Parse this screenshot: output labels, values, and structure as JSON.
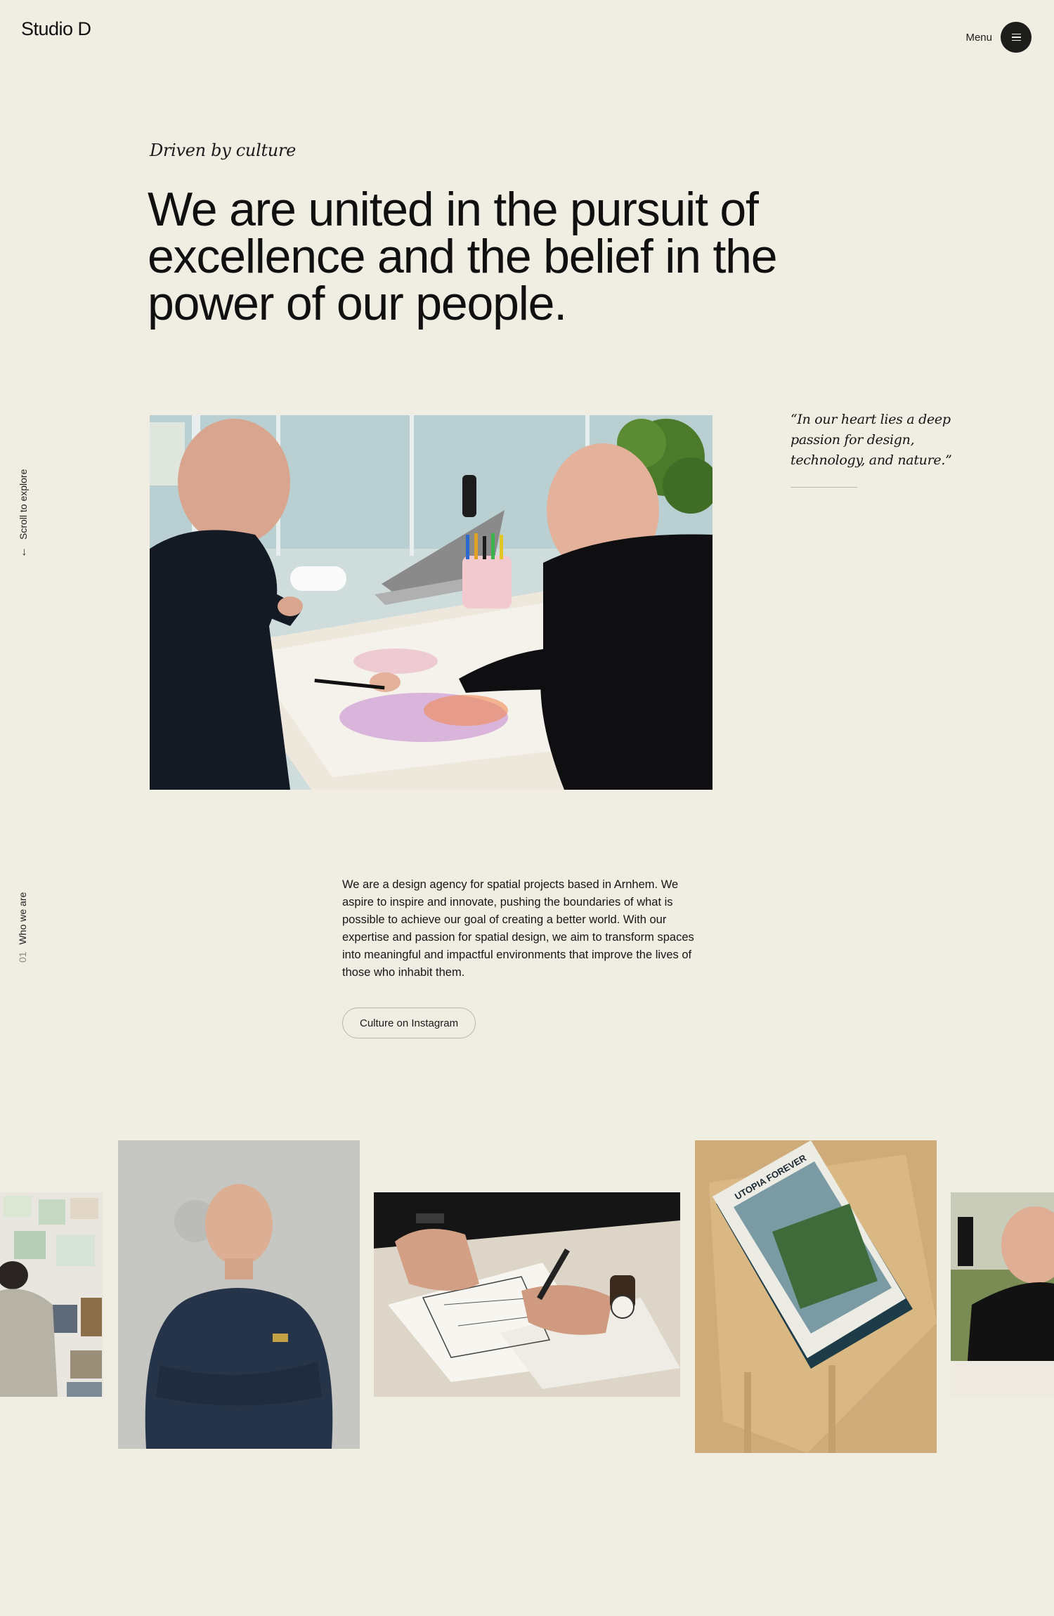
{
  "header": {
    "logo": "Studio D",
    "menu_label": "Menu",
    "menu_icon": "hamburger-icon"
  },
  "rails": {
    "scroll_label": "Scroll to explore",
    "scroll_arrow": "←",
    "section_number": "01",
    "section_label": "Who we are"
  },
  "hero": {
    "kicker": "Driven by culture",
    "headline": "We are united in the pursuit of excellence and the belief in the power of our people."
  },
  "quote": {
    "text": "“In our heart lies a deep passion for design, technology, and nature.”"
  },
  "about": {
    "body": "We are a design agency for spatial projects based in Arnhem. We aspire to inspire and innovate, pushing the boundaries of what is possible to achieve our goal of creating a better world. With our expertise and passion for spatial design, we aim to transform spaces into meaningful and impactful environments that improve the lives of those who inhabit them.",
    "button_label": "Culture on Instagram"
  },
  "gallery": {
    "book_title": "UTOPIA FOREVER"
  },
  "colors": {
    "background": "#f0ede3",
    "text": "#141414",
    "menu_button": "#1d1d1b",
    "button_border": "#b9b6ac"
  }
}
